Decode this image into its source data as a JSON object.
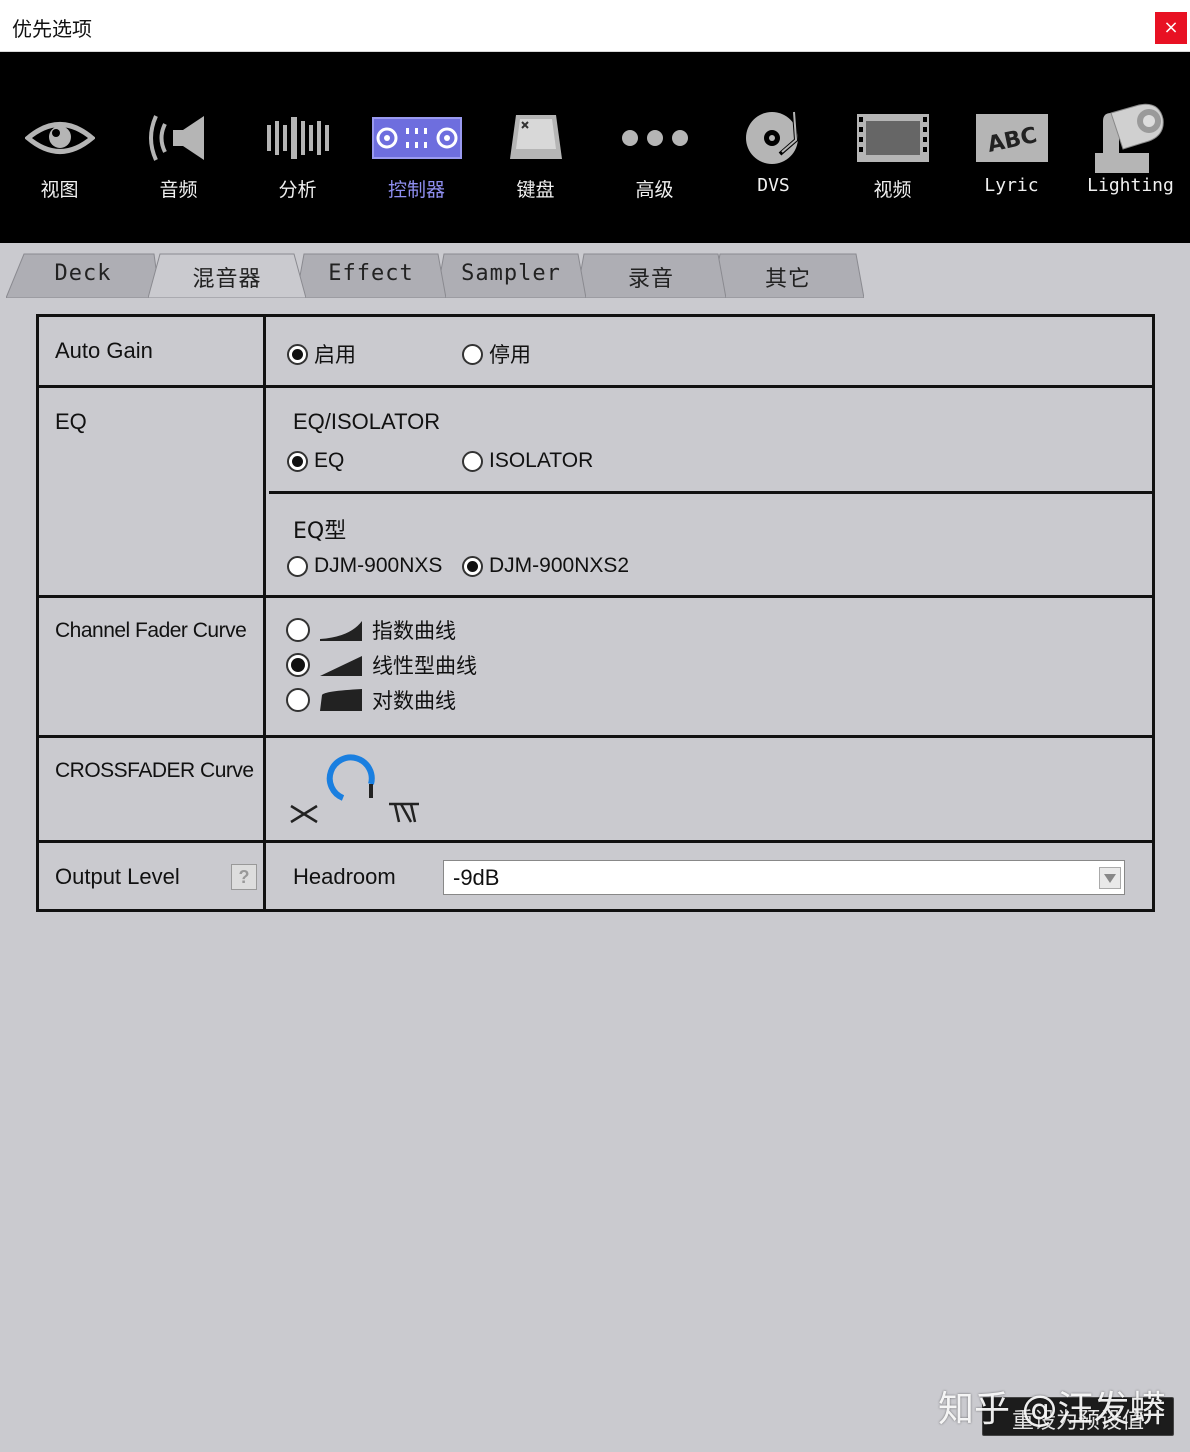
{
  "window": {
    "title": "优先选项",
    "close_label": "×"
  },
  "toolbar": {
    "items": [
      {
        "label": "视图",
        "icon": "eye-icon"
      },
      {
        "label": "音频",
        "icon": "speaker-icon"
      },
      {
        "label": "分析",
        "icon": "waveform-bars-icon"
      },
      {
        "label": "控制器",
        "icon": "controller-icon",
        "active": true
      },
      {
        "label": "键盘",
        "icon": "keyboard-key-icon"
      },
      {
        "label": "高级",
        "icon": "ellipsis-icon"
      },
      {
        "label": "DVS",
        "icon": "turntable-icon"
      },
      {
        "label": "视频",
        "icon": "film-icon"
      },
      {
        "label": "Lyric",
        "icon": "abc-icon"
      },
      {
        "label": "Lighting",
        "icon": "moving-light-icon"
      }
    ],
    "active_color": "#8f8ff0"
  },
  "tabs": {
    "items": [
      "Deck",
      "混音器",
      "Effect",
      "Sampler",
      "录音",
      "其它"
    ],
    "active_index": 1
  },
  "settings": {
    "auto_gain": {
      "label": "Auto Gain",
      "options": [
        "启用",
        "停用"
      ],
      "selected": "启用"
    },
    "eq": {
      "label": "EQ",
      "isolator_title": "EQ/ISOLATOR",
      "isolator_options": [
        "EQ",
        "ISOLATOR"
      ],
      "isolator_selected": "EQ",
      "type_title": "EQ型",
      "type_options": [
        "DJM-900NXS",
        "DJM-900NXS2"
      ],
      "type_selected": "DJM-900NXS2"
    },
    "channel_fader": {
      "label": "Channel Fader Curve",
      "options": [
        "指数曲线",
        "线性型曲线",
        "对数曲线"
      ],
      "selected": "线性型曲线"
    },
    "crossfader": {
      "label": "CROSSFADER Curve",
      "knob_color": "#1a7fe0"
    },
    "output_level": {
      "label": "Output Level",
      "help": "?",
      "field_label": "Headroom",
      "value": "-9dB"
    }
  },
  "footer": {
    "reset_label": "重设为预设值",
    "watermark": "知乎 @汪发蟒"
  }
}
